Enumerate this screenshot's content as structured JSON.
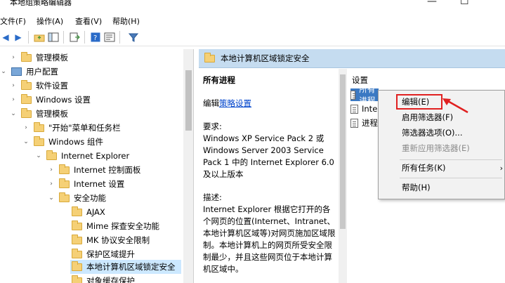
{
  "window": {
    "title": "本地组策略编辑器",
    "min_glyph": "—",
    "max_glyph": "☐"
  },
  "menu": [
    "文件(F)",
    "操作(A)",
    "查看(V)",
    "帮助(H)"
  ],
  "tree": {
    "items": [
      {
        "label": "管理模板",
        "level": 2,
        "expanded": false,
        "icon": "folder"
      },
      {
        "label": "用户配置",
        "level": 0,
        "expanded": true,
        "icon": "computer"
      },
      {
        "label": "软件设置",
        "level": 1,
        "expanded": false,
        "icon": "folder"
      },
      {
        "label": "Windows 设置",
        "level": 1,
        "expanded": false,
        "icon": "folder"
      },
      {
        "label": "管理模板",
        "level": 1,
        "expanded": true,
        "icon": "folder"
      },
      {
        "label": "\"开始\"菜单和任务栏",
        "level": 2,
        "expanded": false,
        "icon": "folder"
      },
      {
        "label": "Windows 组件",
        "level": 2,
        "expanded": true,
        "icon": "folder"
      },
      {
        "label": "Internet Explorer",
        "level": 3,
        "expanded": true,
        "icon": "folder"
      },
      {
        "label": "Internet 控制面板",
        "level": 4,
        "expanded": false,
        "icon": "folder"
      },
      {
        "label": "Internet 设置",
        "level": 4,
        "expanded": false,
        "icon": "folder"
      },
      {
        "label": "安全功能",
        "level": 4,
        "expanded": true,
        "icon": "folder"
      },
      {
        "label": "AJAX",
        "level": 5,
        "icon": "folder"
      },
      {
        "label": "Mime 探查安全功能",
        "level": 5,
        "icon": "folder"
      },
      {
        "label": "MK 协议安全限制",
        "level": 5,
        "icon": "folder"
      },
      {
        "label": "保护区域提升",
        "level": 5,
        "icon": "folder"
      },
      {
        "label": "本地计算机区域锁定安全",
        "level": 5,
        "icon": "folder",
        "selected": true
      },
      {
        "label": "对象缓存保护",
        "level": 5,
        "icon": "folder"
      }
    ]
  },
  "right_pane": {
    "header": "本地计算机区域锁定安全",
    "description": {
      "heading": "所有进程",
      "edit_prefix": "编辑",
      "edit_link": "策略设置",
      "requirements": "要求:\nWindows XP Service Pack 2 或 Windows Server 2003 Service Pack 1 中的 Internet Explorer 6.0 及以上版本",
      "description": "描述:\nInternet Explorer 根据它打开的各个网页的位置(Internet、Intranet、本地计算机区域等)对网页施加区域限制。本地计算机上的网页所受安全限制最少，并且这些网页位于本地计算机区域中。"
    },
    "list": {
      "column_header": "设置",
      "rows": [
        "所有进程",
        "Inte",
        "进程"
      ]
    }
  },
  "context_menu": {
    "items": [
      {
        "label": "编辑(E)",
        "enabled": true,
        "highlighted": true
      },
      {
        "label": "启用筛选器(F)",
        "enabled": true
      },
      {
        "label": "筛选器选项(O)...",
        "enabled": true
      },
      {
        "label": "重新应用筛选器(E)",
        "enabled": false
      },
      {
        "label": "所有任务(K)",
        "enabled": true,
        "submenu": true
      },
      {
        "label": "帮助(H)",
        "enabled": true
      }
    ]
  },
  "colors": {
    "header_bg": "#c5dcf0",
    "selection": "#cce8ff",
    "highlight_red": "#e02020",
    "link": "#0044cc"
  }
}
